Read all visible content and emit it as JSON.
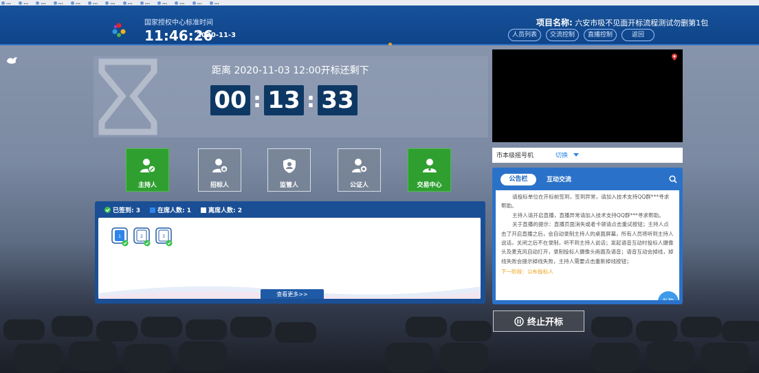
{
  "bookmarks": [
    "…",
    "…",
    "…",
    "…",
    "…",
    "…",
    "…",
    "…",
    "…",
    "…",
    "…",
    "…",
    "…"
  ],
  "header": {
    "clock_label": "国家授权中心标准时间",
    "time": "11:46:26",
    "date": "2020-11-3",
    "project_label": "项目名称:",
    "project_name": "六安市吸不见面开标流程测试勿删第1包",
    "buttons": [
      "人员列表",
      "交流控制",
      "直播控制",
      "返回"
    ]
  },
  "countdown": {
    "label": "距离 2020-11-03 12:00开标还剩下",
    "hours": "00",
    "minutes": "13",
    "seconds": "33",
    "separator": ":"
  },
  "roles": [
    {
      "label": "主持人",
      "active": true
    },
    {
      "label": "招标人",
      "active": false
    },
    {
      "label": "监管人",
      "active": false
    },
    {
      "label": "公证人",
      "active": false
    },
    {
      "label": "交易中心",
      "active": true
    }
  ],
  "attendance": {
    "signed": "已签到: 3",
    "present": "在席人数: 1",
    "absent": "离席人数: 2",
    "seats": [
      "1",
      "2",
      "3"
    ],
    "more": "查看更多>>"
  },
  "selector": {
    "label": "市本级摇号机",
    "action": "切换"
  },
  "notice": {
    "tab_active": "公告栏",
    "tab_other": "互动交流",
    "paragraphs": [
      "请投标单位在开标前签到，签到异常，请加入技术支持QQ群***寻求帮助。",
      "主持人请开启直播，直播异常请加入技术支持QQ群***寻求帮助。",
      "关于直播的提示：直播页面消失或者卡顿请点击重试按钮；主持人点击了开启直播之后，会自动录制主持人的桌面屏幕，所有人员将听到主持人说话，关闭之后不在录制，听不到主持人说话；发起语音互动时投标人摄像头及麦克风自动打开，录制投标人摄像头画面及语音；语音互动会掉线，掉线失败会提示掉线失败，主持人需要点击重新掉线按钮；"
    ],
    "next": "下一阶段：公布投标人",
    "chat": "私聊"
  },
  "stop_button": "终止开标",
  "colors": {
    "green": "#2fa030",
    "blue": "#1a4f96",
    "accent": "#2f84ea"
  }
}
